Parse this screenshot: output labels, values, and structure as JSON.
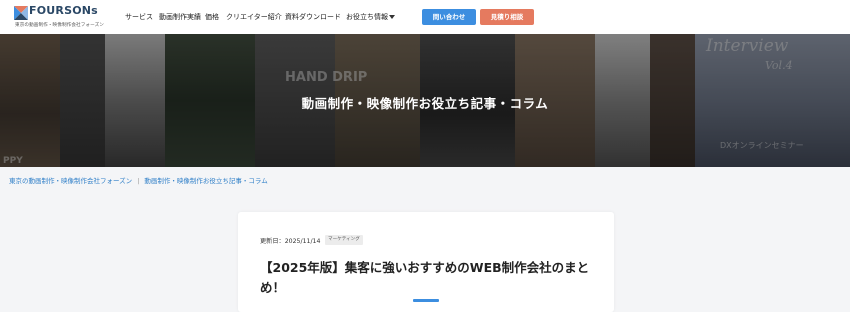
{
  "header": {
    "logo_text": "FOURSONs",
    "logo_tagline": "東京の動画制作・映像制作会社フォーズン",
    "nav": [
      "サービス",
      "動画制作実績",
      "価格",
      "クリエイター紹介",
      "資料ダウンロード",
      "お役立ち情報"
    ],
    "contact_label": "問い合わせ",
    "estimate_label": "見積り相談"
  },
  "hero": {
    "title": "動画制作・映像制作お役立ち記事・コラム",
    "overlay_texts": [
      "HAND DRIP",
      "Interview",
      "Vol.4",
      "DXオンラインセミナー",
      "PPY"
    ]
  },
  "breadcrumb": {
    "home": "東京の動画制作・映像制作会社フォーズン",
    "separator": "|",
    "current": "動画制作・映像制作お役立ち記事・コラム"
  },
  "article": {
    "updated": "更新日：2025/11/14",
    "tag": "マーケティング",
    "title": "【2025年版】集客に強いおすすめのWEB制作会社のまとめ！"
  },
  "colors": {
    "accent_blue": "#3c8ee0",
    "accent_orange": "#e57a5f",
    "brand_navy": "#2b4866",
    "link_blue": "#2f7fc8"
  }
}
